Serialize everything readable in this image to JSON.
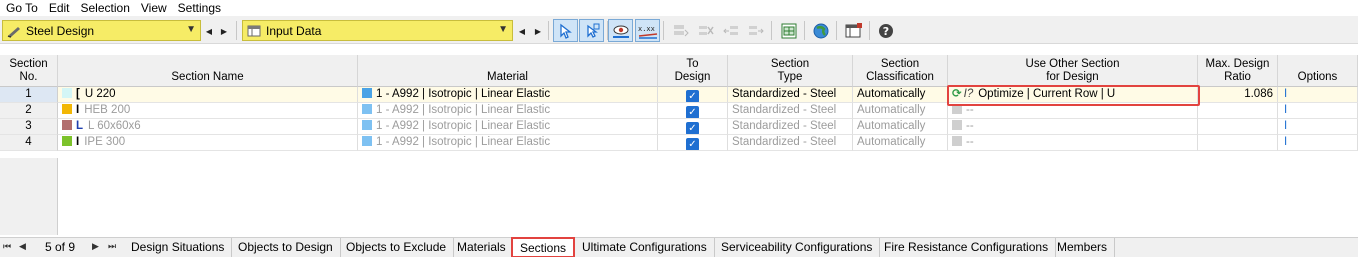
{
  "menu": [
    "Go To",
    "Edit",
    "Selection",
    "View",
    "Settings"
  ],
  "toolbar": {
    "module_combo": "Steel Design",
    "data_combo": "Input Data"
  },
  "table": {
    "headers": {
      "section_no": [
        "Section",
        "No."
      ],
      "section_name": "Section Name",
      "material": "Material",
      "to_design": [
        "To",
        "Design"
      ],
      "section_type": [
        "Section",
        "Type"
      ],
      "classification": [
        "Section",
        "Classification"
      ],
      "other_section": [
        "Use Other Section",
        "for Design"
      ],
      "max_ratio": [
        "Max. Design",
        "Ratio"
      ],
      "options": "Options"
    },
    "rows": [
      {
        "no": "1",
        "name": "U 220",
        "material": "1 - A992 | Isotropic | Linear Elastic",
        "type": "Standardized - Steel",
        "classification": "Automatically",
        "other": "Optimize | Current Row | U",
        "ratio": "1.086",
        "swatch": "#d4f6f6"
      },
      {
        "no": "2",
        "name": "HEB 200",
        "material": "1 - A992 | Isotropic | Linear Elastic",
        "type": "Standardized - Steel",
        "classification": "Automatically",
        "other": "--",
        "ratio": "",
        "swatch": "#f2b705"
      },
      {
        "no": "3",
        "name": "L 60x60x6",
        "material": "1 - A992 | Isotropic | Linear Elastic",
        "type": "Standardized - Steel",
        "classification": "Automatically",
        "other": "--",
        "ratio": "",
        "swatch": "#b26e6e"
      },
      {
        "no": "4",
        "name": "IPE 300",
        "material": "1 - A992 | Isotropic | Linear Elastic",
        "type": "Standardized - Steel",
        "classification": "Automatically",
        "other": "--",
        "ratio": "",
        "swatch": "#7cc22b"
      }
    ]
  },
  "pager": "5 of 9",
  "tabs": [
    "Design Situations",
    "Objects to Design",
    "Objects to Exclude",
    "Materials",
    "Sections",
    "Ultimate Configurations",
    "Serviceability Configurations",
    "Fire Resistance Configurations",
    "Members"
  ],
  "active_tab": "Sections",
  "colors": {
    "accent": "#1f6fd1",
    "highlight": "#e2433f",
    "combo": "#f6ec66"
  }
}
